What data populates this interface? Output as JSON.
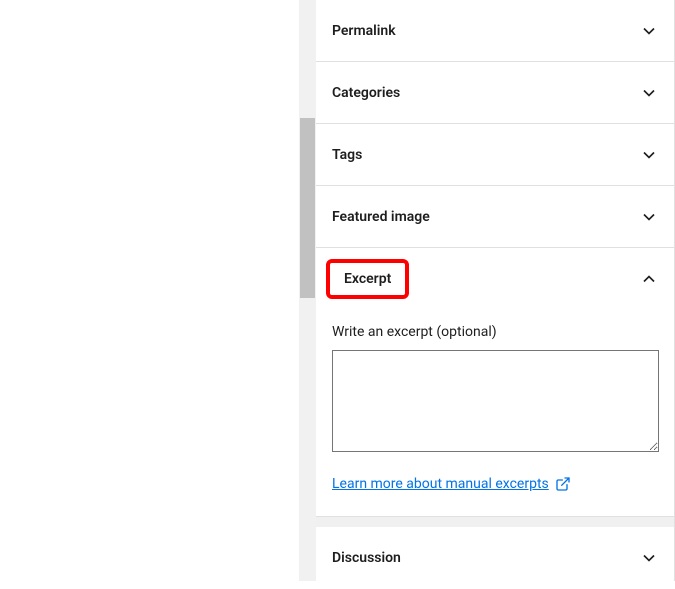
{
  "panels": {
    "permalink": "Permalink",
    "categories": "Categories",
    "tags": "Tags",
    "featured_image": "Featured image",
    "excerpt": "Excerpt",
    "discussion": "Discussion"
  },
  "excerpt_body": {
    "label": "Write an excerpt (optional)",
    "textarea_value": "",
    "learn_link": "Learn more about manual excerpts"
  }
}
